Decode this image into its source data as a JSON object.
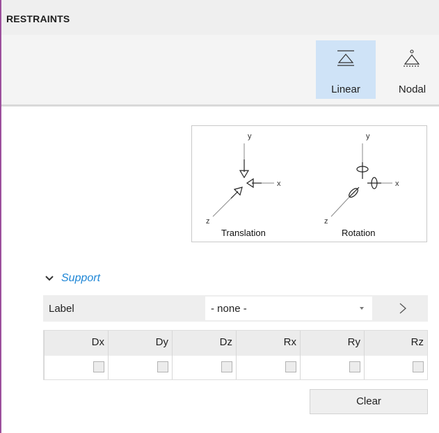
{
  "panel": {
    "title": "RESTRAINTS"
  },
  "toolbar": {
    "tools": [
      {
        "label": "Linear",
        "icon": "linear-support-icon",
        "active": true
      },
      {
        "label": "Nodal",
        "icon": "nodal-support-icon",
        "active": false
      }
    ]
  },
  "diagram": {
    "translation_caption": "Translation",
    "rotation_caption": "Rotation",
    "axis_x": "x",
    "axis_y": "y",
    "axis_z": "z"
  },
  "support": {
    "section_title": "Support",
    "label_field": "Label",
    "label_value": "- none -",
    "columns": [
      "Dx",
      "Dy",
      "Dz",
      "Rx",
      "Ry",
      "Rz"
    ],
    "checked": [
      false,
      false,
      false,
      false,
      false,
      false
    ],
    "clear_label": "Clear"
  },
  "colors": {
    "accent": "#1e86d6",
    "active_tool_bg": "#cfe3f7",
    "window_border": "#9c4f9c"
  }
}
